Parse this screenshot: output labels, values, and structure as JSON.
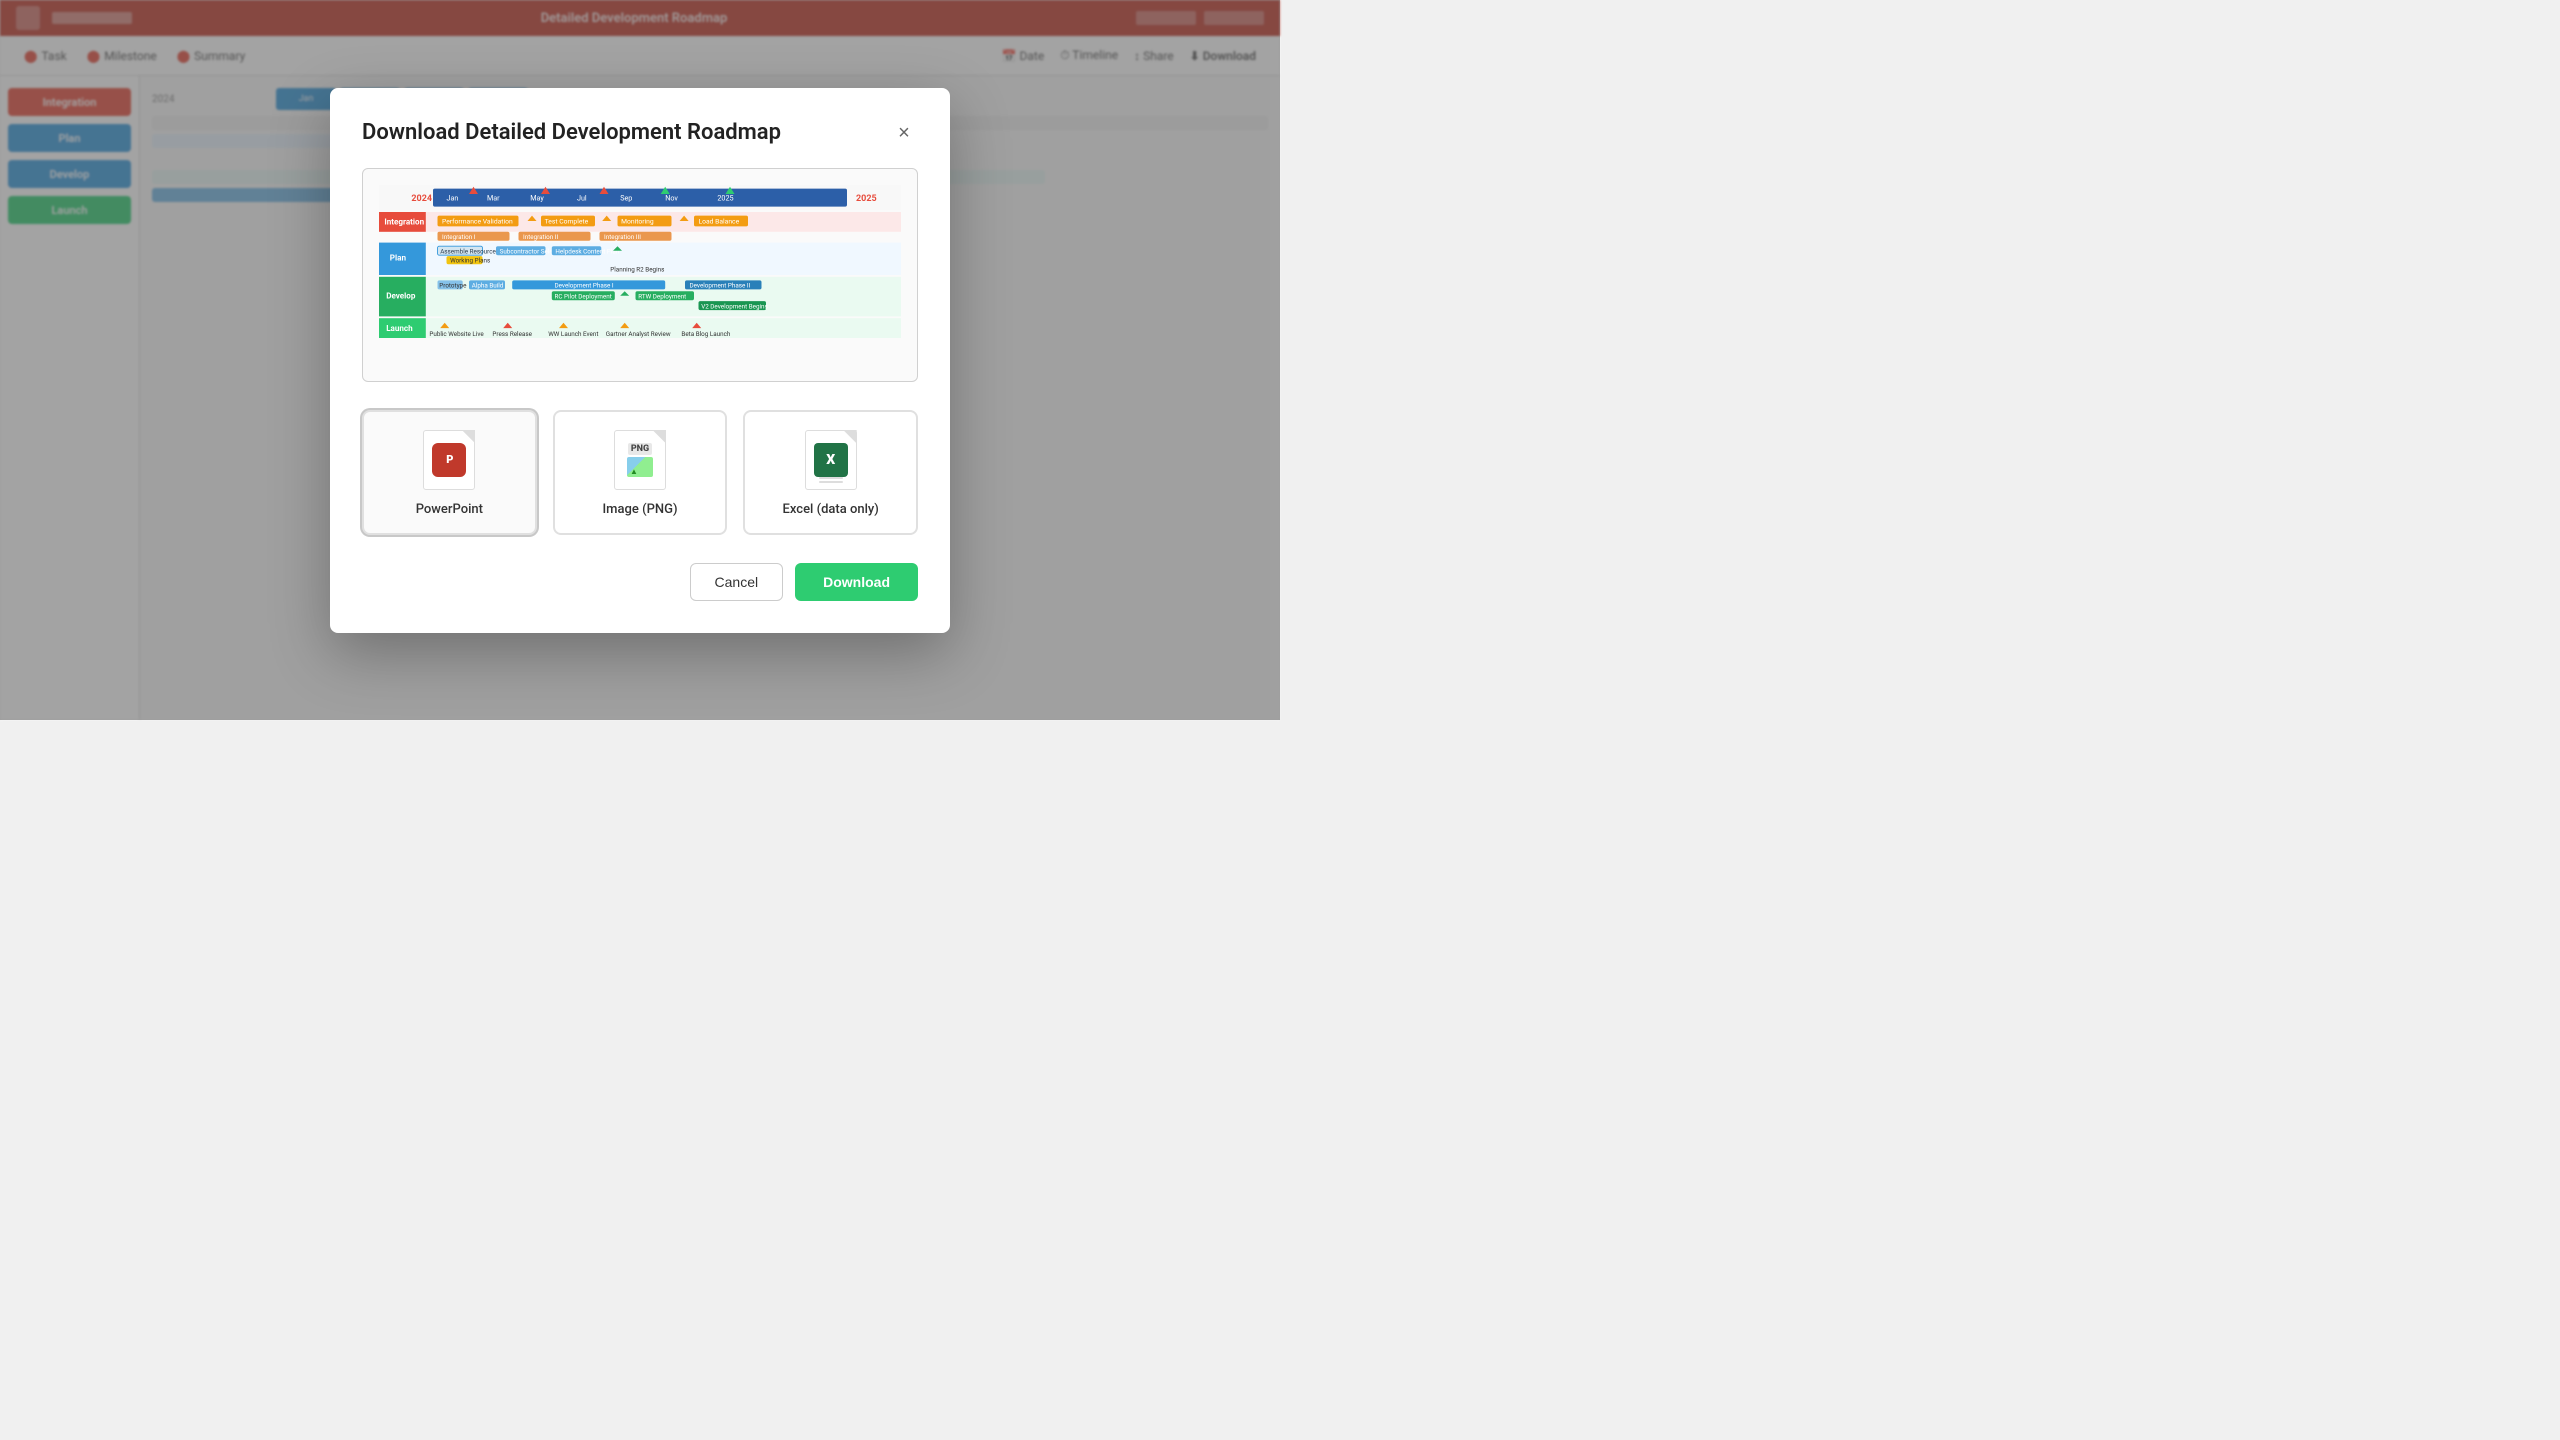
{
  "app": {
    "title": "Detailed Development Roadmap",
    "header_bg": "#c0392b"
  },
  "modal": {
    "title": "Download Detailed Development Roadmap",
    "close_label": "×",
    "preview_alt": "Gantt chart preview of Development Roadmap",
    "formats": [
      {
        "id": "powerpoint",
        "label": "PowerPoint",
        "selected": true,
        "icon_type": "ppt"
      },
      {
        "id": "png",
        "label": "Image (PNG)",
        "selected": false,
        "icon_type": "png"
      },
      {
        "id": "excel",
        "label": "Excel (data only)",
        "selected": false,
        "icon_type": "xls"
      }
    ],
    "cancel_label": "Cancel",
    "download_label": "Download"
  },
  "colors": {
    "download_btn_bg": "#2ecc71",
    "cancel_btn_border": "#ccc",
    "modal_bg": "#ffffff",
    "overlay_bg": "rgba(0,0,0,0.35)"
  }
}
